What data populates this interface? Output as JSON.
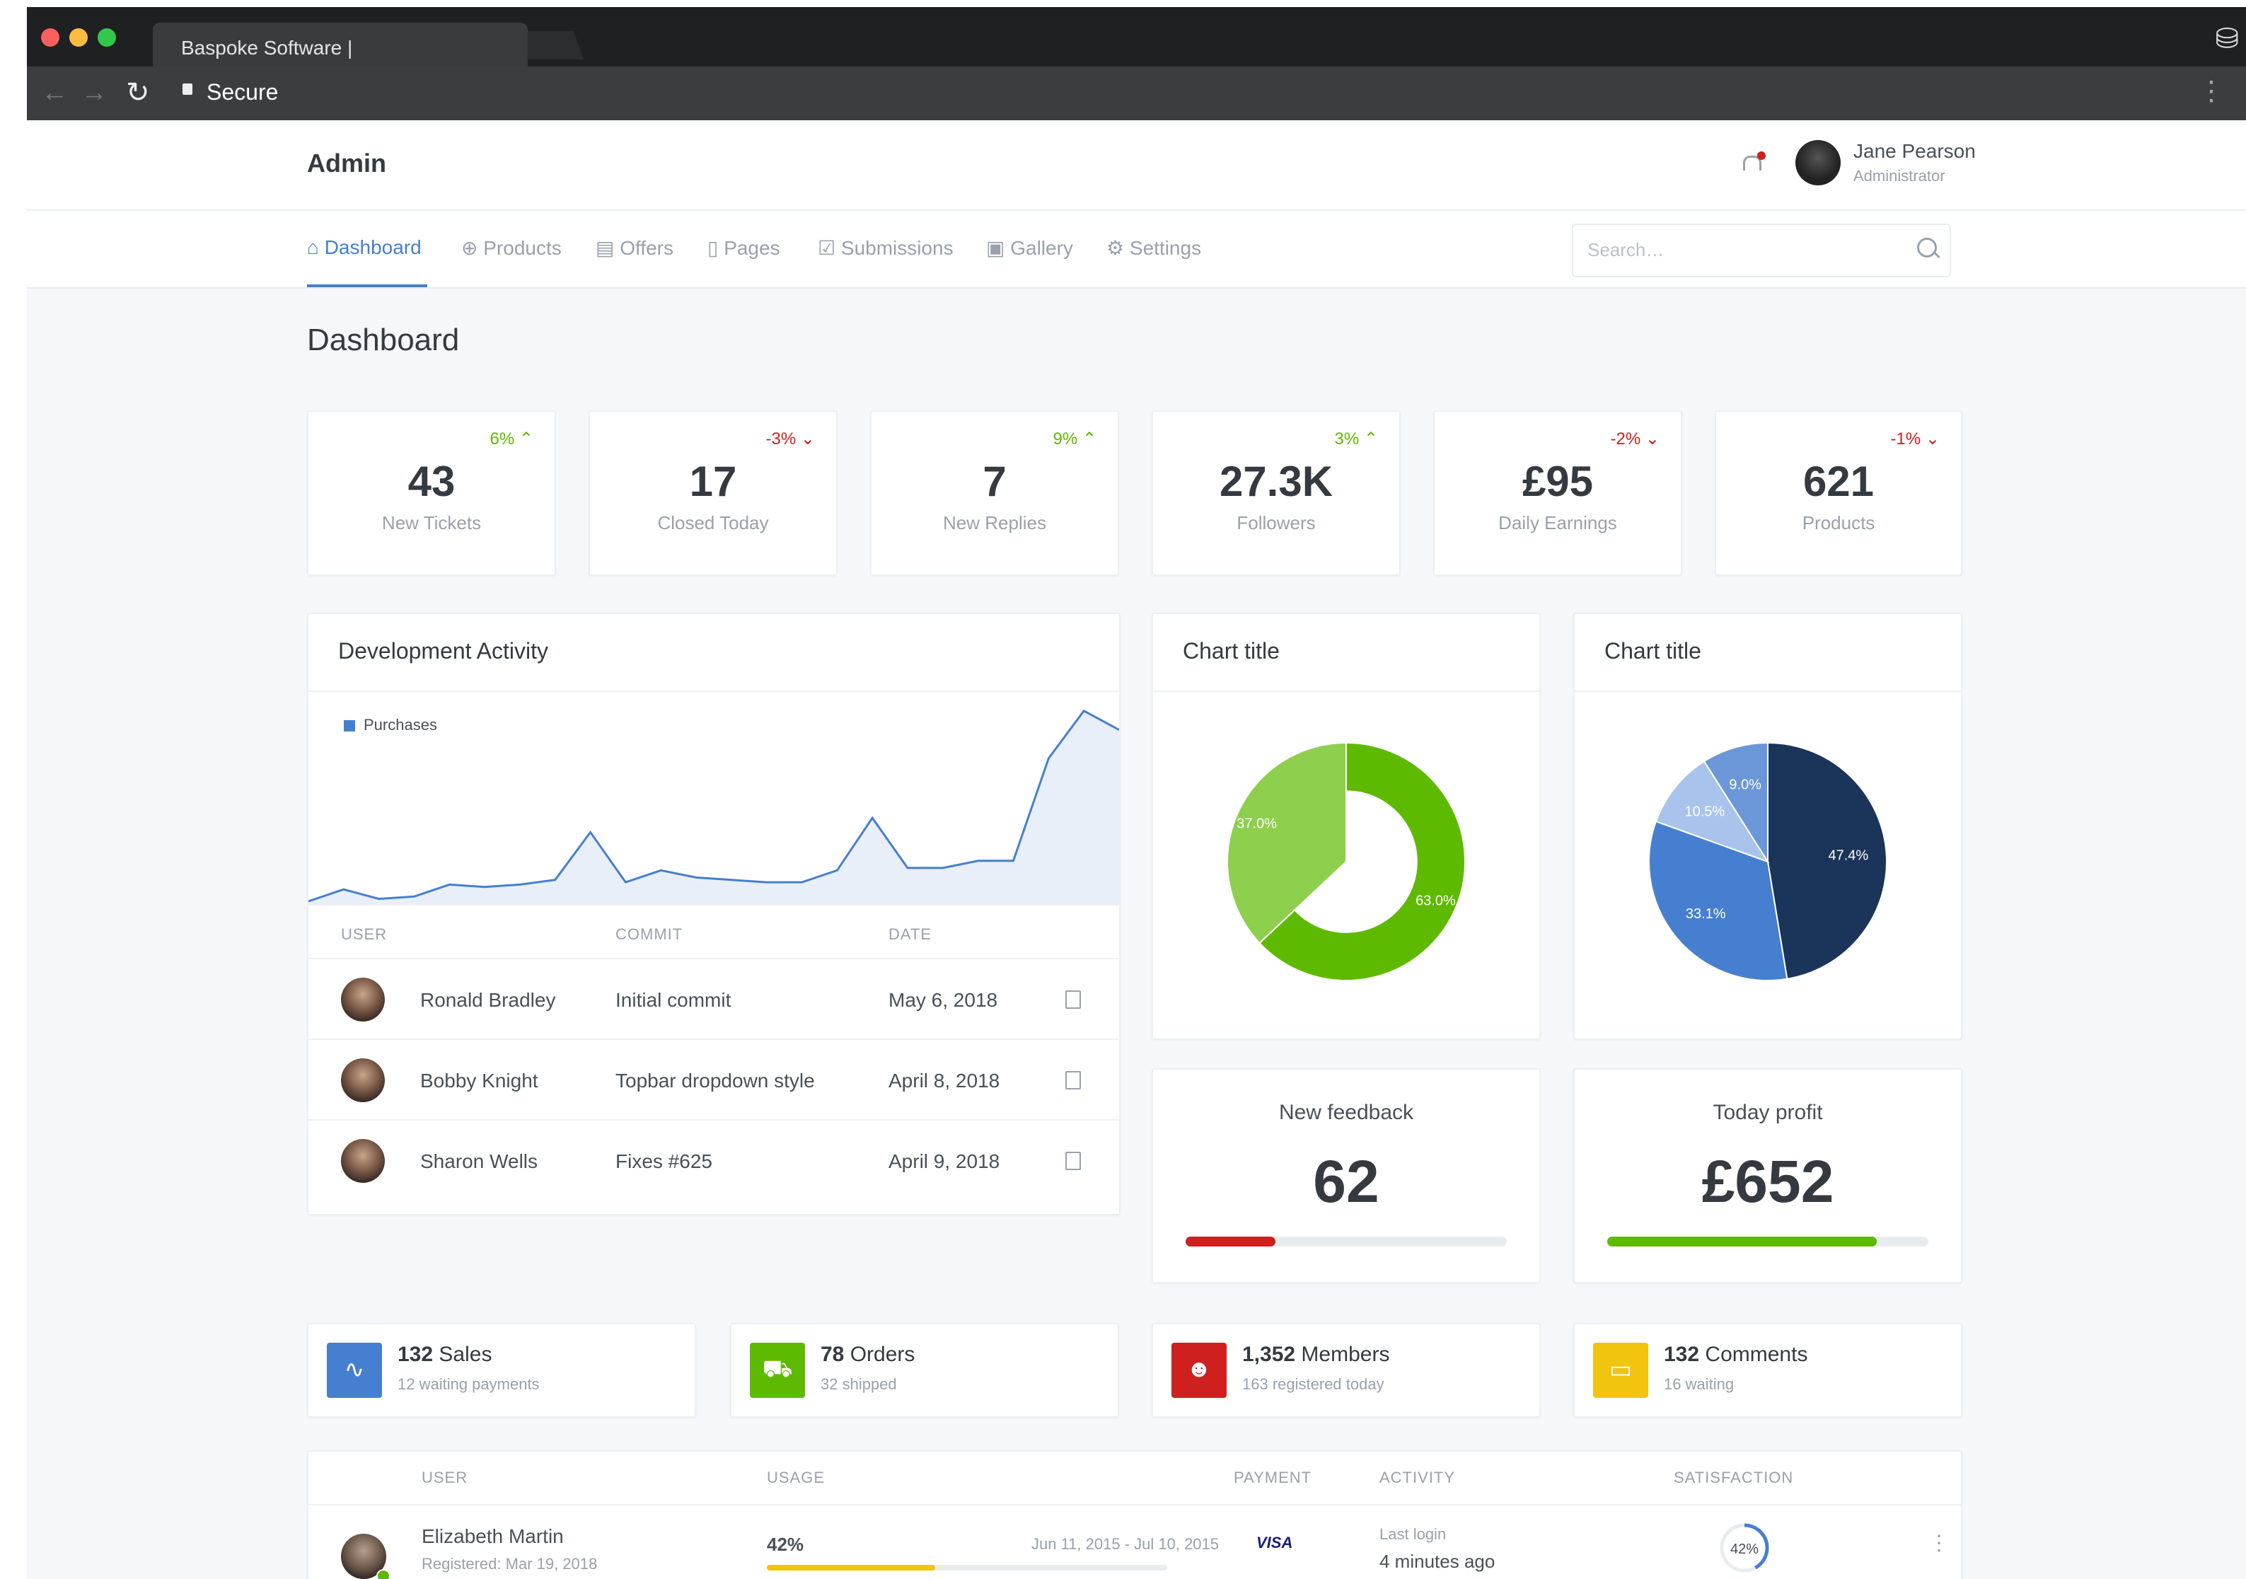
{
  "browser": {
    "tab_title": "Baspoke Software |",
    "secure_label": "Secure"
  },
  "header": {
    "brand": "Admin",
    "user_name": "Jane Pearson",
    "user_role": "Administrator"
  },
  "nav": {
    "items": [
      {
        "label": "Dashboard",
        "icon": "home-icon"
      },
      {
        "label": "Products",
        "icon": "box-icon"
      },
      {
        "label": "Offers",
        "icon": "calendar-icon"
      },
      {
        "label": "Pages",
        "icon": "file-icon"
      },
      {
        "label": "Submissions",
        "icon": "check-square-icon"
      },
      {
        "label": "Gallery",
        "icon": "image-icon"
      },
      {
        "label": "Settings",
        "icon": "settings-icon"
      }
    ],
    "search_placeholder": "Search…"
  },
  "page_title": "Dashboard",
  "stats": [
    {
      "value": "43",
      "label": "New Tickets",
      "change": "6%",
      "dir": "up"
    },
    {
      "value": "17",
      "label": "Closed Today",
      "change": "-3%",
      "dir": "down"
    },
    {
      "value": "7",
      "label": "New Replies",
      "change": "9%",
      "dir": "up"
    },
    {
      "value": "27.3K",
      "label": "Followers",
      "change": "3%",
      "dir": "up"
    },
    {
      "value": "£95",
      "label": "Daily Earnings",
      "change": "-2%",
      "dir": "down"
    },
    {
      "value": "621",
      "label": "Products",
      "change": "-1%",
      "dir": "down"
    }
  ],
  "dev_activity": {
    "title": "Development Activity",
    "legend": "Purchases",
    "columns": [
      "USER",
      "COMMIT",
      "DATE"
    ],
    "rows": [
      {
        "user": "Ronald Bradley",
        "commit": "Initial commit",
        "date": "May 6, 2018"
      },
      {
        "user": "Bobby Knight",
        "commit": "Topbar dropdown style",
        "date": "April 8, 2018"
      },
      {
        "user": "Sharon Wells",
        "commit": "Fixes #625",
        "date": "April 9, 2018"
      }
    ]
  },
  "chart_data": [
    {
      "type": "area",
      "series": [
        {
          "name": "Purchases",
          "values": [
            0,
            5,
            1,
            2,
            7,
            6,
            7,
            9,
            29,
            8,
            13,
            10,
            9,
            8,
            8,
            13,
            35,
            14,
            14,
            17,
            17,
            60,
            80,
            72
          ],
          "color": "#467fcf"
        }
      ]
    },
    {
      "type": "pie",
      "title": "Chart title",
      "donut": true,
      "labels": [
        "63.0%",
        "37.0%"
      ],
      "values": [
        63.0,
        37.0
      ],
      "colors": [
        "#5eba00",
        "#8ecf4d"
      ]
    },
    {
      "type": "pie",
      "title": "Chart title",
      "labels": [
        "47.4%",
        "33.1%",
        "10.5%",
        "9.0%"
      ],
      "values": [
        47.4,
        33.1,
        10.5,
        9.0
      ],
      "colors": [
        "#1b3459",
        "#467fcf",
        "#a8c4ec",
        "#6b97d9"
      ]
    }
  ],
  "kpis": [
    {
      "title": "New feedback",
      "value": "62",
      "progress": 0.28,
      "color": "#cd201f"
    },
    {
      "title": "Today profit",
      "value": "£652",
      "progress": 0.84,
      "color": "#5eba00"
    }
  ],
  "small_stats": [
    {
      "count": "132",
      "label": "Sales",
      "sub": "12 waiting payments",
      "color": "#467fcf",
      "icon": "activity-icon"
    },
    {
      "count": "78",
      "label": "Orders",
      "sub": "32 shipped",
      "color": "#5eba00",
      "icon": "cart-icon"
    },
    {
      "count": "1,352",
      "label": "Members",
      "sub": "163 registered today",
      "color": "#cd201f",
      "icon": "users-icon"
    },
    {
      "count": "132",
      "label": "Comments",
      "sub": "16 waiting",
      "color": "#f1c40f",
      "icon": "message-icon"
    }
  ],
  "users_table": {
    "columns": [
      "USER",
      "USAGE",
      "PAYMENT",
      "ACTIVITY",
      "SATISFACTION"
    ],
    "rows": [
      {
        "name": "Elizabeth Martin",
        "registered": "Registered: Mar 19, 2018",
        "usage": "42%",
        "usage_value": 0.42,
        "period": "Jun 11, 2015 - Jul 10, 2015",
        "payment": "VISA",
        "activity_label": "Last login",
        "activity_value": "4 minutes ago",
        "satisfaction": "42%",
        "satisfaction_value": 0.42
      }
    ]
  }
}
